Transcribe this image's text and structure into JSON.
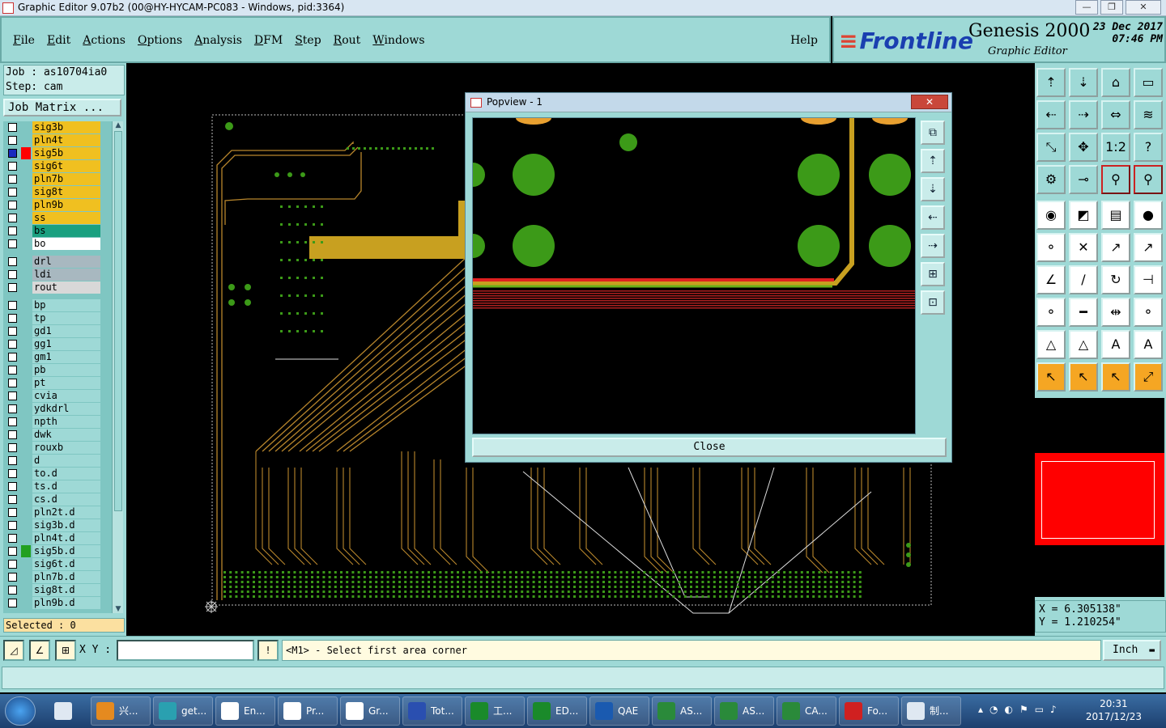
{
  "window": {
    "title": "Graphic Editor 9.07b2 (00@HY-HYCAM-PC083 - Windows, pid:3364)",
    "buttons": [
      "—",
      "❐",
      "✕"
    ]
  },
  "menu": {
    "items": [
      "File",
      "Edit",
      "Actions",
      "Options",
      "Analysis",
      "DFM",
      "Step",
      "Rout",
      "Windows"
    ],
    "help": "Help"
  },
  "brand": {
    "logo": "Frontline",
    "product": "Genesis 2000",
    "subtitle": "Graphic Editor",
    "date": "23 Dec 2017",
    "time": "07:46 PM"
  },
  "job": {
    "job_label": "Job : as10704ia0",
    "step_label": "Step: cam",
    "matrix_button": "Job Matrix ..."
  },
  "layers": [
    {
      "name": "sig3b",
      "color": "#f0c020",
      "swatch": ""
    },
    {
      "name": "pln4t",
      "color": "#f0c020",
      "swatch": ""
    },
    {
      "name": "sig5b",
      "color": "#f0c020",
      "swatch": "#ff0000",
      "active": true
    },
    {
      "name": "sig6t",
      "color": "#f0c020",
      "swatch": ""
    },
    {
      "name": "pln7b",
      "color": "#f0c020",
      "swatch": ""
    },
    {
      "name": "sig8t",
      "color": "#f0c020",
      "swatch": ""
    },
    {
      "name": "pln9b",
      "color": "#f0c020",
      "swatch": ""
    },
    {
      "name": "ss",
      "color": "#f0c020",
      "swatch": ""
    },
    {
      "name": "bs",
      "color": "#1aa080",
      "swatch": ""
    },
    {
      "name": "bo",
      "color": "#ffffff",
      "swatch": ""
    },
    {
      "name": "drl",
      "color": "#a8b8c0",
      "swatch": ""
    },
    {
      "name": "ldi",
      "color": "#a8b8c0",
      "swatch": ""
    },
    {
      "name": "rout",
      "color": "#d8d8d8",
      "swatch": ""
    },
    {
      "name": "bp",
      "color": "#9ed9d6",
      "swatch": ""
    },
    {
      "name": "tp",
      "color": "#9ed9d6",
      "swatch": ""
    },
    {
      "name": "gd1",
      "color": "#9ed9d6",
      "swatch": ""
    },
    {
      "name": "gg1",
      "color": "#9ed9d6",
      "swatch": ""
    },
    {
      "name": "gm1",
      "color": "#9ed9d6",
      "swatch": ""
    },
    {
      "name": "pb",
      "color": "#9ed9d6",
      "swatch": ""
    },
    {
      "name": "pt",
      "color": "#9ed9d6",
      "swatch": ""
    },
    {
      "name": "cvia",
      "color": "#9ed9d6",
      "swatch": ""
    },
    {
      "name": "ydkdrl",
      "color": "#9ed9d6",
      "swatch": ""
    },
    {
      "name": "npth",
      "color": "#9ed9d6",
      "swatch": ""
    },
    {
      "name": "dwk",
      "color": "#9ed9d6",
      "swatch": ""
    },
    {
      "name": "rouxb",
      "color": "#9ed9d6",
      "swatch": ""
    },
    {
      "name": "d",
      "color": "#9ed9d6",
      "swatch": ""
    },
    {
      "name": "to.d",
      "color": "#9ed9d6",
      "swatch": ""
    },
    {
      "name": "ts.d",
      "color": "#9ed9d6",
      "swatch": ""
    },
    {
      "name": "cs.d",
      "color": "#9ed9d6",
      "swatch": ""
    },
    {
      "name": "pln2t.d",
      "color": "#9ed9d6",
      "swatch": ""
    },
    {
      "name": "sig3b.d",
      "color": "#9ed9d6",
      "swatch": ""
    },
    {
      "name": "pln4t.d",
      "color": "#9ed9d6",
      "swatch": ""
    },
    {
      "name": "sig5b.d",
      "color": "#9ed9d6",
      "swatch": "#22a020"
    },
    {
      "name": "sig6t.d",
      "color": "#9ed9d6",
      "swatch": ""
    },
    {
      "name": "pln7b.d",
      "color": "#9ed9d6",
      "swatch": ""
    },
    {
      "name": "sig8t.d",
      "color": "#9ed9d6",
      "swatch": ""
    },
    {
      "name": "pln9b.d",
      "color": "#9ed9d6",
      "swatch": ""
    }
  ],
  "selected_label": "Selected : 0",
  "popview": {
    "title": "Popview - 1",
    "title_close": "✕",
    "close_button": "Close",
    "tool_icons": [
      "zoom-home-icon",
      "pan-up-icon",
      "pan-down-icon",
      "pan-left-icon",
      "pan-right-icon",
      "zoom-in-icon",
      "zoom-out-icon"
    ],
    "tool_glyphs": [
      "⧉",
      "⇡",
      "⇣",
      "⇠",
      "⇢",
      "⊞",
      "⊡"
    ]
  },
  "toolbar": {
    "rows": [
      [
        "⇡",
        "⇣",
        "⌂",
        "▭"
      ],
      [
        "⇠",
        "⇢",
        "⇔",
        "≋"
      ],
      [
        "⤡",
        "✥",
        "1:2",
        "?"
      ],
      [
        "⚙",
        "⊸",
        "⚲",
        "⚲"
      ],
      [
        "◉",
        "◩",
        "▤",
        "●"
      ],
      [
        "⚬",
        "✕",
        "↗",
        "↗"
      ],
      [
        "∠",
        "∕",
        "↻",
        "⊣"
      ],
      [
        "⚬",
        "━",
        "⇹",
        "⚬"
      ],
      [
        "△",
        "△",
        "A",
        "A"
      ],
      [
        "↖",
        "↖",
        "↖",
        "⤢"
      ]
    ]
  },
  "coords": {
    "x": "X = 6.305138\"",
    "y": "Y = 1.210254\""
  },
  "command": {
    "xy_label": "X Y :",
    "xy_value": "",
    "prompt": "<M1> - Select first area corner",
    "unit": "Inch"
  },
  "taskbar": {
    "items": [
      "兴...",
      "get...",
      "En...",
      "Pr...",
      "Gr...",
      "Tot...",
      "工...",
      "ED...",
      "QAE",
      "AS...",
      "AS...",
      "CA...",
      "Fo...",
      "制..."
    ],
    "clock_time": "20:31",
    "clock_date": "2017/12/23"
  }
}
